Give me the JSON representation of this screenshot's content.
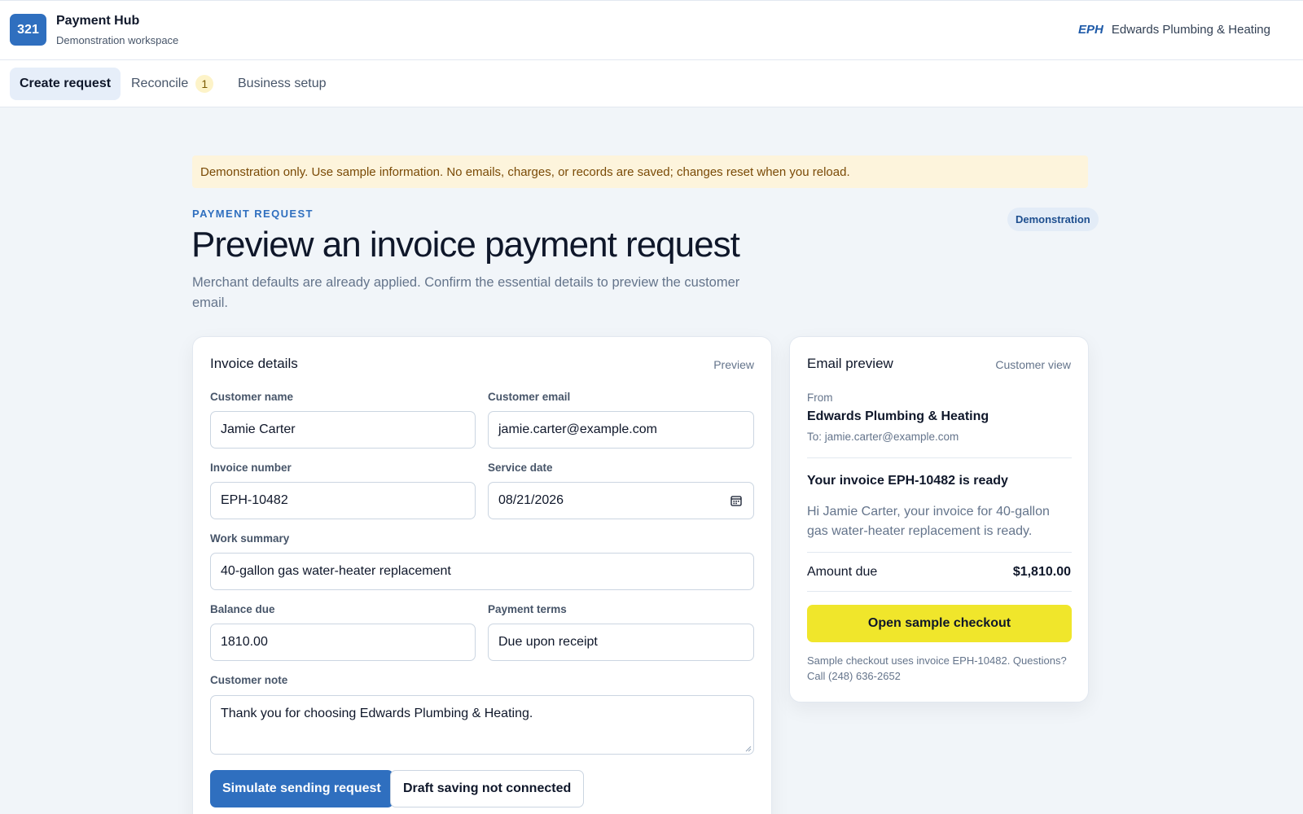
{
  "app": {
    "logo_text": "321",
    "title": "Payment Hub",
    "subtitle": "Demonstration workspace",
    "merchant_abbr": "EPH",
    "merchant_name": "Edwards Plumbing & Heating"
  },
  "tabs": [
    {
      "label": "Create request",
      "active": true
    },
    {
      "label": "Reconcile",
      "count": "1"
    },
    {
      "label": "Business setup"
    }
  ],
  "notice": "Demonstration only. Use sample information. No emails, charges, or records are saved; changes reset when you reload.",
  "page": {
    "eyebrow": "PAYMENT REQUEST",
    "badge": "Demonstration",
    "title": "Preview an invoice payment request",
    "description": "Merchant defaults are already applied. Confirm the essential details to preview the customer email."
  },
  "form": {
    "title": "Invoice details",
    "meta": "Preview",
    "fields": {
      "customer_name": {
        "label": "Customer name",
        "value": "Jamie Carter"
      },
      "customer_email": {
        "label": "Customer email",
        "value": "jamie.carter@example.com"
      },
      "invoice_number": {
        "label": "Invoice number",
        "value": "EPH-10482"
      },
      "service_date": {
        "label": "Service date",
        "value": "08/21/2026"
      },
      "work_summary": {
        "label": "Work summary",
        "value": "40-gallon gas water-heater replacement"
      },
      "balance_due": {
        "label": "Balance due",
        "value": "1810.00"
      },
      "payment_terms": {
        "label": "Payment terms",
        "value": "Due upon receipt"
      },
      "customer_note": {
        "label": "Customer note",
        "value": "Thank you for choosing Edwards Plumbing & Heating."
      }
    },
    "primary_button": "Simulate sending request",
    "secondary_button": "Draft saving not connected"
  },
  "email_preview": {
    "title": "Email preview",
    "meta": "Customer view",
    "from_label": "From",
    "from": "Edwards Plumbing & Heating",
    "to": "To: jamie.carter@example.com",
    "subject": "Your invoice EPH-10482 is ready",
    "body": "Hi Jamie Carter, your invoice for 40-gallon gas water-heater replacement is ready.",
    "amount_label": "Amount due",
    "amount": "$1,810.00",
    "checkout_button": "Open sample checkout",
    "footer": "Sample checkout uses invoice EPH-10482. Questions? Call (248) 636-2652"
  },
  "colors": {
    "brand": "#2f6fbf",
    "checkout": "#f0e62b",
    "notice_bg": "#fdf4dc"
  },
  "icons": {
    "service_date": "calendar-icon",
    "customer_note": "resize-handle-icon"
  }
}
